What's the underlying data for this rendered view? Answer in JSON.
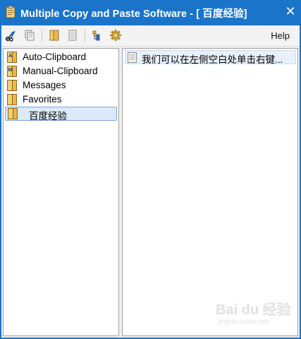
{
  "titlebar": {
    "title": "Multiple Copy and Paste Software - [ 百度经验]",
    "close_glyph": "✕"
  },
  "toolbar": {
    "buttons": [
      {
        "name": "cut-icon"
      },
      {
        "name": "copy-icon"
      },
      {
        "name": "folder-icon"
      },
      {
        "name": "document-icon"
      },
      {
        "name": "tree-icon"
      },
      {
        "name": "gear-icon"
      }
    ],
    "help_label": "Help"
  },
  "tree": {
    "items": [
      {
        "label": "Auto-Clipboard",
        "badge": "A",
        "selected": false
      },
      {
        "label": "Manual-Clipboard",
        "badge": "M",
        "selected": false
      },
      {
        "label": "Messages",
        "badge": "",
        "selected": false
      },
      {
        "label": "Favorites",
        "badge": "",
        "selected": false
      },
      {
        "label": "百度经验",
        "badge": "",
        "selected": true
      }
    ]
  },
  "clips": {
    "items": [
      {
        "label": "我们可以在左侧空白处单击右键..."
      }
    ]
  },
  "watermark": {
    "text": "Bai du 经验",
    "sub": "jingyan.baidu.com"
  },
  "colors": {
    "titlebar": "#1a74c9",
    "selection": "#dbe9f8",
    "folder": "#e8b84a"
  }
}
